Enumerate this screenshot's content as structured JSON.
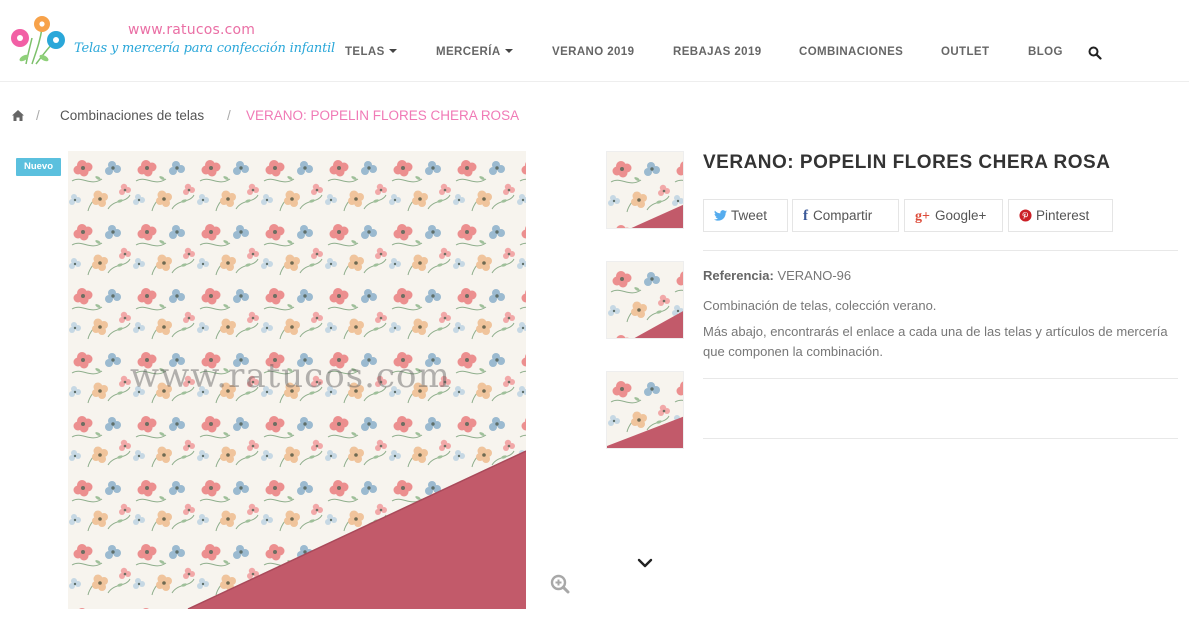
{
  "header": {
    "logo": {
      "url_text": "www.ratucos.com",
      "tagline": "Telas y mercería para confección infantil"
    },
    "nav": [
      {
        "label": "TELAS",
        "has_dropdown": true
      },
      {
        "label": "MERCERÍA",
        "has_dropdown": true
      },
      {
        "label": "VERANO 2019",
        "has_dropdown": false
      },
      {
        "label": "REBAJAS 2019",
        "has_dropdown": false
      },
      {
        "label": "COMBINACIONES",
        "has_dropdown": false
      },
      {
        "label": "OUTLET",
        "has_dropdown": false
      },
      {
        "label": "BLOG",
        "has_dropdown": false
      }
    ],
    "search_icon": "search-icon"
  },
  "breadcrumb": {
    "home_icon": "home-icon",
    "separator": "/",
    "items": [
      "Combinaciones de telas",
      "VERANO: POPELIN FLORES CHERA ROSA"
    ]
  },
  "product": {
    "badge": "Nuevo",
    "watermark": "www.ratucos.com",
    "title": "VERANO: POPELIN FLORES CHERA ROSA",
    "share": [
      {
        "label": "Tweet",
        "icon": "twitter-icon",
        "color": "#55acee"
      },
      {
        "label": "Compartir",
        "icon": "facebook-icon",
        "color": "#3b5998"
      },
      {
        "label": "Google+",
        "icon": "google-plus-icon",
        "color": "#dd4b39"
      },
      {
        "label": "Pinterest",
        "icon": "pinterest-icon",
        "color": "#cb2027"
      }
    ],
    "reference_label": "Referencia:",
    "reference_value": "VERANO-96",
    "description_short": "Combinación de telas, colección verano.",
    "description_long": "Más abajo, encontrarás el enlace a cada una de las telas y artículos de mercería que componen la combinación."
  },
  "colors": {
    "accent_pink": "#f07ab6",
    "badge_blue": "#5bc0de",
    "fabric_rose": "#c25a6a",
    "fabric_background": "#f7f4ee"
  }
}
